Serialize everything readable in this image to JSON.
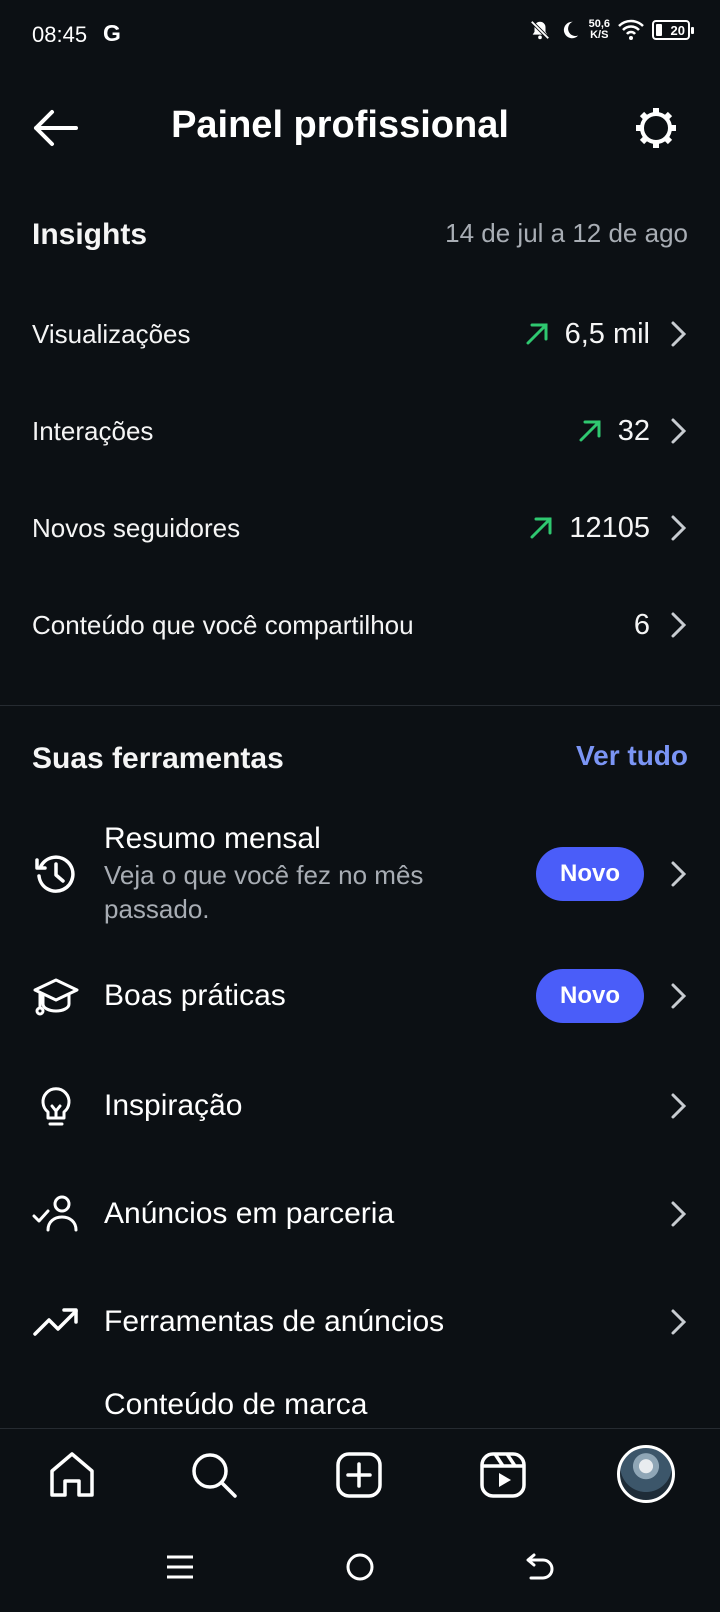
{
  "status_bar": {
    "time": "08:45",
    "carrier_icon": "G",
    "net_speed_value": "50,6",
    "net_speed_unit": "K/S",
    "battery": "20",
    "icons": [
      "bell-off-icon",
      "moon-icon",
      "wifi-icon",
      "battery-icon"
    ]
  },
  "header": {
    "title": "Painel profissional",
    "back_icon": "arrow-left-icon",
    "settings_icon": "gear-icon"
  },
  "insights": {
    "title": "Insights",
    "date_range": "14 de jul a 12 de ago",
    "rows": [
      {
        "label": "Visualizações",
        "value": "6,5 mil",
        "trend": "up"
      },
      {
        "label": "Interações",
        "value": "32",
        "trend": "up"
      },
      {
        "label": "Novos seguidores",
        "value": "12105",
        "trend": "up"
      },
      {
        "label": "Conteúdo que você compartilhou",
        "value": "6",
        "trend": "none"
      }
    ]
  },
  "tools": {
    "title": "Suas ferramentas",
    "see_all": "Ver tudo",
    "items": [
      {
        "label": "Resumo mensal",
        "subtitle": "Veja o que você fez no mês passado.",
        "badge": "Novo",
        "icon": "history-clock-icon"
      },
      {
        "label": "Boas práticas",
        "badge": "Novo",
        "icon": "graduation-cap-icon"
      },
      {
        "label": "Inspiração",
        "icon": "lightbulb-icon"
      },
      {
        "label": "Anúncios em parceria",
        "icon": "person-check-icon"
      },
      {
        "label": "Ferramentas de anúncios",
        "icon": "trending-up-icon"
      },
      {
        "label": "Conteúdo de marca",
        "icon": ""
      }
    ]
  },
  "colors": {
    "background": "#0c1014",
    "accent_link": "#7b95f5",
    "badge": "#4a5df9",
    "trend_up": "#2fc870",
    "muted_text": "#a8adb4"
  },
  "bottom_nav": [
    "home-icon",
    "search-icon",
    "create-icon",
    "reels-icon",
    "profile-avatar"
  ],
  "system_nav": [
    "menu-icon",
    "home-circle-icon",
    "back-icon"
  ]
}
